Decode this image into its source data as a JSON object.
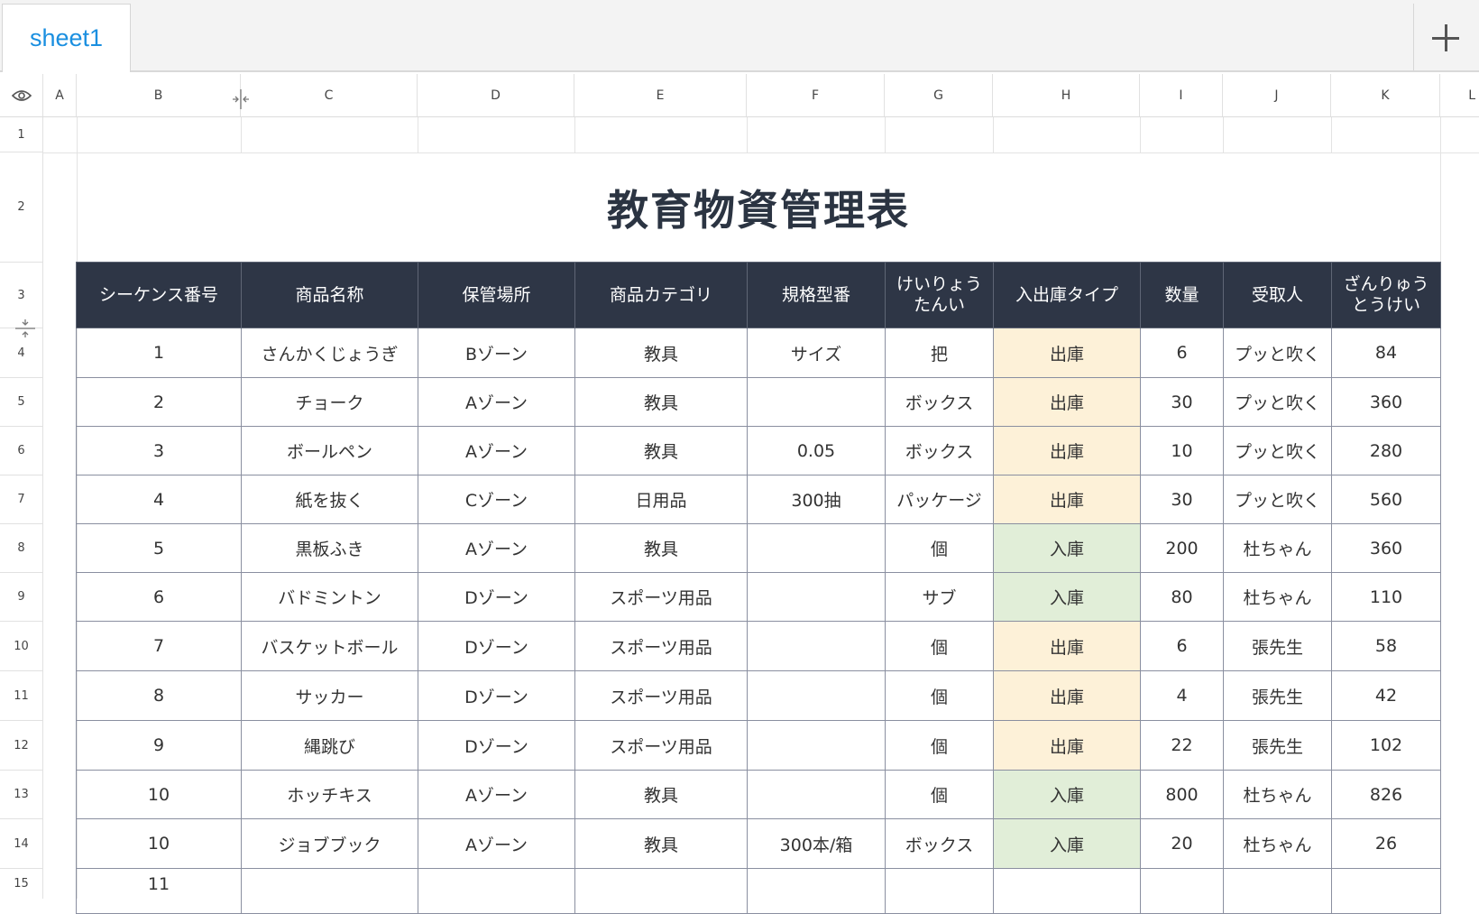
{
  "tabs": {
    "active": "sheet1"
  },
  "columns": [
    "A",
    "B",
    "C",
    "D",
    "E",
    "F",
    "G",
    "H",
    "I",
    "J",
    "K",
    "L"
  ],
  "rows": [
    "1",
    "2",
    "3",
    "4",
    "5",
    "6",
    "7",
    "8",
    "9",
    "10",
    "11",
    "12",
    "13",
    "14",
    "15"
  ],
  "title": "教育物資管理表",
  "headers": [
    "シーケンス番号",
    "商品名称",
    "保管場所",
    "商品カテゴリ",
    "規格型番",
    "けいりょう\nたんい",
    "入出庫タイプ",
    "数量",
    "受取人",
    "ざんりゅう\nとうけい"
  ],
  "records": [
    [
      "1",
      "さんかくじょうぎ",
      "Bゾーン",
      "教具",
      "サイズ",
      "把",
      "出庫",
      "6",
      "プッと吹く",
      "84"
    ],
    [
      "2",
      "チョーク",
      "Aゾーン",
      "教具",
      "",
      "ボックス",
      "出庫",
      "30",
      "プッと吹く",
      "360"
    ],
    [
      "3",
      "ボールペン",
      "Aゾーン",
      "教具",
      "0.05",
      "ボックス",
      "出庫",
      "10",
      "プッと吹く",
      "280"
    ],
    [
      "4",
      "紙を抜く",
      "Cゾーン",
      "日用品",
      "300抽",
      "パッケージ",
      "出庫",
      "30",
      "プッと吹く",
      "560"
    ],
    [
      "5",
      "黒板ふき",
      "Aゾーン",
      "教具",
      "",
      "個",
      "入庫",
      "200",
      "杜ちゃん",
      "360"
    ],
    [
      "6",
      "バドミントン",
      "Dゾーン",
      "スポーツ用品",
      "",
      "サブ",
      "入庫",
      "80",
      "杜ちゃん",
      "110"
    ],
    [
      "7",
      "バスケットボール",
      "Dゾーン",
      "スポーツ用品",
      "",
      "個",
      "出庫",
      "6",
      "張先生",
      "58"
    ],
    [
      "8",
      "サッカー",
      "Dゾーン",
      "スポーツ用品",
      "",
      "個",
      "出庫",
      "4",
      "張先生",
      "42"
    ],
    [
      "9",
      "縄跳び",
      "Dゾーン",
      "スポーツ用品",
      "",
      "個",
      "出庫",
      "22",
      "張先生",
      "102"
    ],
    [
      "10",
      "ホッチキス",
      "Aゾーン",
      "教具",
      "",
      "個",
      "入庫",
      "800",
      "杜ちゃん",
      "826"
    ],
    [
      "10",
      "ジョブブック",
      "Aゾーン",
      "教具",
      "300本/箱",
      "ボックス",
      "入庫",
      "20",
      "杜ちゃん",
      "26"
    ],
    [
      "11",
      "",
      "",
      "",
      "",
      "",
      "",
      "",
      "",
      ""
    ]
  ],
  "colors": {
    "header_bg": "#2e3646",
    "out_bg": "#fdf1d8",
    "in_bg": "#e1eed8",
    "tab_text": "#1a8fe0"
  }
}
